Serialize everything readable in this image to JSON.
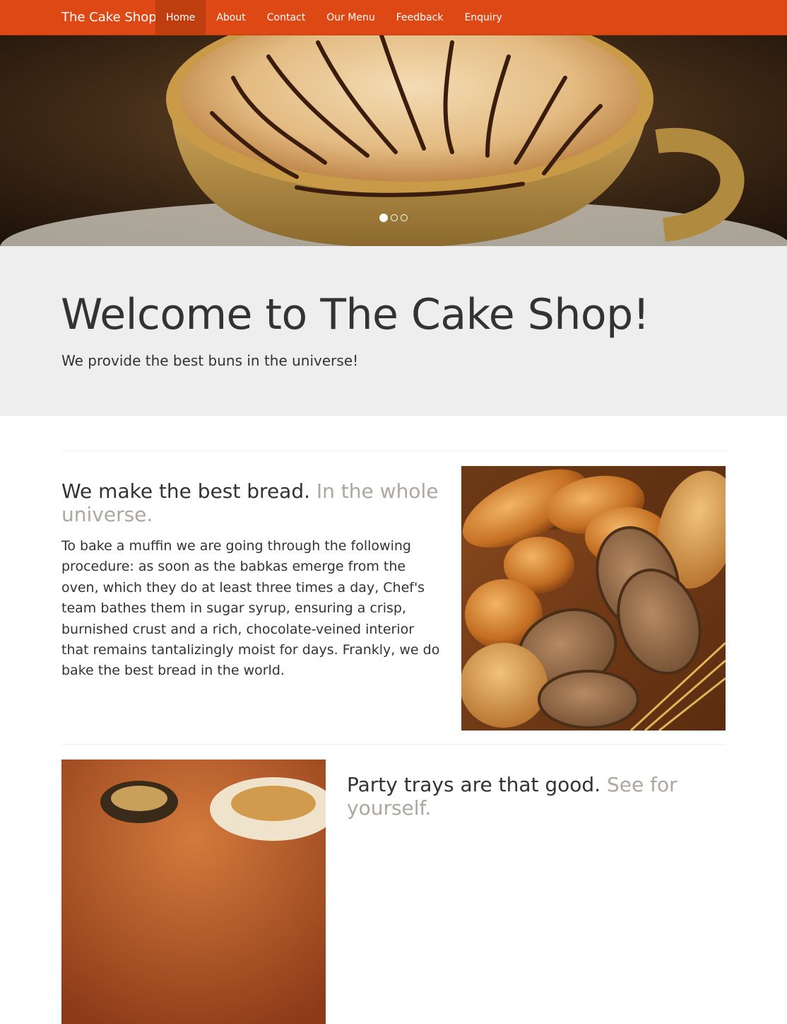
{
  "navbar": {
    "brand": "The Cake Shop",
    "items": [
      {
        "label": "Home",
        "active": true
      },
      {
        "label": "About"
      },
      {
        "label": "Contact"
      },
      {
        "label": "Our Menu"
      },
      {
        "label": "Feedback"
      },
      {
        "label": "Enquiry"
      }
    ],
    "color": "#dd4814"
  },
  "carousel": {
    "slide_count": 3,
    "active_slide": 1
  },
  "jumbotron": {
    "title": "Welcome to The Cake Shop!",
    "subtitle": "We provide the best buns in the universe!"
  },
  "featurettes": [
    {
      "heading": "We make the best bread.",
      "heading_muted": "In the whole universe.",
      "text": "To bake a muffin we are going through the following procedure: as soon as the babkas emerge from the oven, which they do at least three times a day, Chef's team bathes them in sugar syrup, ensuring a crisp, burnished crust and a rich, chocolate-veined interior that remains tantalizingly moist for days. Frankly, we do bake the best bread in the world."
    },
    {
      "heading": "Party trays are that good.",
      "heading_muted": "See for yourself."
    }
  ],
  "colors": {
    "accent": "#dd4814",
    "muted": "#aea79f",
    "jumbotron_bg": "#eeeeee"
  }
}
